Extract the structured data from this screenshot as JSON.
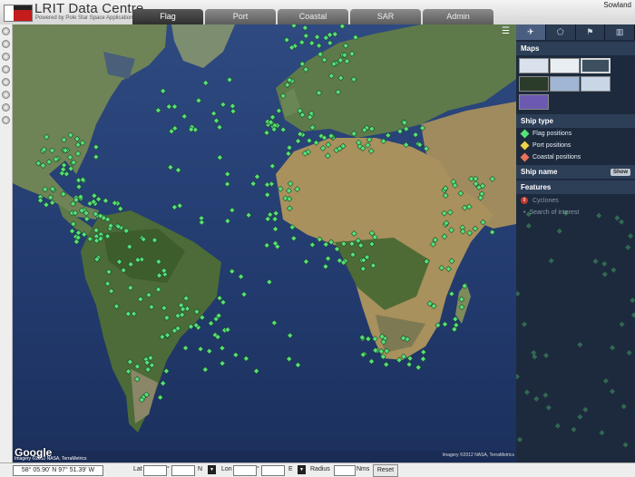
{
  "app": {
    "title": "LRIT Data Centre",
    "subtitle": "Powered by Pole Star Space Applications",
    "user": "Sowland"
  },
  "tabs": [
    {
      "label": "Flag",
      "active": true
    },
    {
      "label": "Port",
      "active": false
    },
    {
      "label": "Coastal",
      "active": false
    },
    {
      "label": "SAR",
      "active": false
    },
    {
      "label": "Admin",
      "active": false
    }
  ],
  "map": {
    "google_logo": "Google",
    "credit_left": "Imagery ©2012 NASA, TerraMetrics",
    "credit_right": "Imagery ©2012 NASA, TerraMetrics",
    "marker_color": "#58e07a"
  },
  "panel": {
    "maps_heading": "Maps",
    "map_thumbs": [
      "",
      "",
      "",
      "",
      "",
      "",
      ""
    ],
    "ship_type_heading": "Ship type",
    "ship_types": [
      {
        "label": "Flag positions",
        "color": "#58e07a"
      },
      {
        "label": "Port positions",
        "color": "#f0d24a"
      },
      {
        "label": "Coastal positions",
        "color": "#e8725a"
      }
    ],
    "ship_name_heading": "Ship name",
    "show_label": "Show",
    "features_heading": "Features",
    "cyclones_label": "Cyclones",
    "search_label": "Search of interest"
  },
  "bottom": {
    "coord_readout": "58° 05.90' N 97° 51.39' W",
    "lat_label": "Lat",
    "lat_deg_mark": "°",
    "lat_hemi": "N",
    "lon_label": "Lon",
    "lon_deg_mark": "°",
    "lon_hemi": "E",
    "radius_label": "Radius",
    "units_label": "Nms",
    "reset_label": "Reset"
  }
}
